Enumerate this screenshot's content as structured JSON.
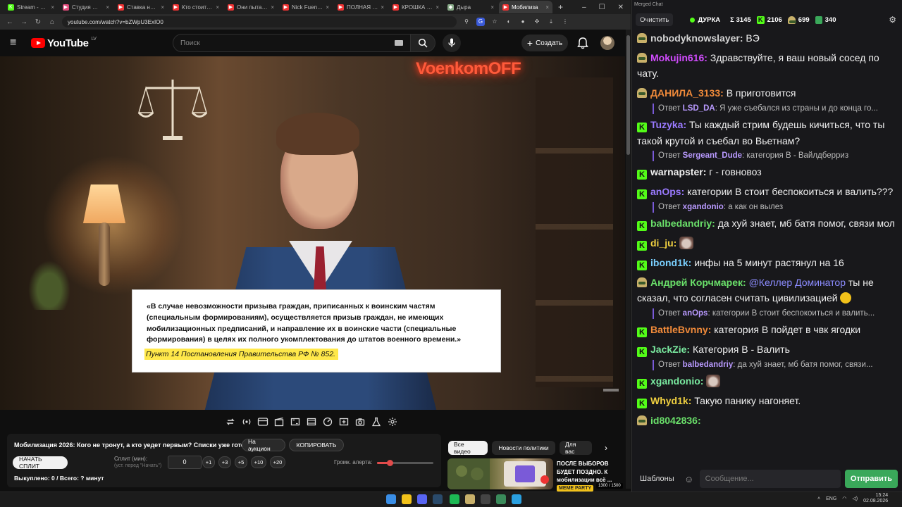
{
  "browser": {
    "tabs": [
      {
        "label": "Stream - Kick D",
        "color": "#53fc18",
        "glyph": "K"
      },
      {
        "label": "Студия — VK В",
        "color": "#e14b7b",
        "glyph": "▶"
      },
      {
        "label": "Ставка на выж",
        "color": "#e33",
        "glyph": "▶"
      },
      {
        "label": "Кто стоит за эт",
        "color": "#e33",
        "glyph": "▶"
      },
      {
        "label": "Они пытались",
        "color": "#e33",
        "glyph": "▶"
      },
      {
        "label": "Nick Fuentes Is",
        "color": "#e33",
        "glyph": "▶"
      },
      {
        "label": "ПОЛНАЯ ВСЕЛ",
        "color": "#e33",
        "glyph": "▶"
      },
      {
        "label": "КРОШКА ВЕНЯ",
        "color": "#e33",
        "glyph": "▶"
      },
      {
        "label": "Дыра",
        "color": "#8a8",
        "glyph": "◆"
      },
      {
        "label": "Мобилиза",
        "color": "#e33",
        "glyph": "▶"
      }
    ],
    "url": "youtube.com/watch?v=bZWpU3ExIO0"
  },
  "youtube": {
    "logo_text": "YouTube",
    "logo_region": "LV",
    "search_placeholder": "Поиск",
    "create_label": "Создать"
  },
  "video": {
    "neon_sign": "VoenkomOFF",
    "quote": "«В случае невозможности призыва граждан, приписанных к воинским частям (специальным формированиям), осуществляется призыв граждан, не имеющих мобилизационных предписаний, и направление их в воинские части (специальные формирования) в целях их полного укомплектования до штатов военного времени.»",
    "quote_source": "Пункт 14 Постановления Правительства РФ № 852."
  },
  "panel": {
    "title": "Мобилизация 2026: Кого не тронут, а кто уедет первым? Списки уже готовы",
    "auction_label": "На аукцион",
    "copy_label": "КОПИРОВАТЬ",
    "split_button": "НАЧАТЬ СПЛИТ",
    "split_label": "Сплит (мин):",
    "split_sublabel": "(уст. перед \"Начать\")",
    "split_value": "0",
    "increments": [
      "+1",
      "+3",
      "+5",
      "+10",
      "+20"
    ],
    "alert_label": "Громк. алерта:",
    "alert_volume": 0.22,
    "bought_text": "Выкуплено: 0 / Всего: ? минут"
  },
  "recommendations": {
    "chips": [
      "Все видео",
      "Новости политики",
      "Для вас"
    ],
    "selected_chip": 0,
    "card_title": "ПОСЛЕ ВЫБОРОВ БУДЕТ ПОЗДНО. К мобилизации всё ...",
    "card_badge": "MEME PARTY",
    "card_duration": "1300 / 1500"
  },
  "chat": {
    "window_title": "Merged Chat",
    "clear_label": "Очистить",
    "channel": "ДУРКА",
    "stat_sum": "Σ 3145",
    "stat_kick": "2106",
    "stat_hat": "699",
    "stat_green": "340",
    "messages": [
      {
        "badge": "hat",
        "user": "nobodyknowslayer",
        "color": "#d4d4d4",
        "text": "ВЭ"
      },
      {
        "badge": "hat",
        "user": "Mokujin616",
        "color": "#d24cff",
        "text": "Здравствуйте, я ваш новый сосед по чату."
      },
      {
        "badge": "hat",
        "user": "ДАНИЛА_3133",
        "color": "#f08a3a",
        "text": "В приготовится",
        "reply_user": "LSD_DA",
        "reply_text": "Я уже съебался из страны и до конца го..."
      },
      {
        "badge": "k",
        "user": "Tuzyka",
        "color": "#9a7aff",
        "text": "Ты каждый стрим будешь кичиться, что ты такой крутой и съебал во Вьетнам?",
        "reply_user": "Sergeant_Dude",
        "reply_text": "категория В - Вайлдберриз"
      },
      {
        "badge": "k",
        "user": "warnapster",
        "color": "#f0f0f0",
        "text": "г - говновоз"
      },
      {
        "badge": "k",
        "user": "anOps",
        "color": "#9a7aff",
        "text": "категории В стоит беспокоиться и валить???",
        "reply_user": "xgandonio",
        "reply_text": "а как он вылез"
      },
      {
        "badge": "k",
        "user": "balbedandriy",
        "color": "#6ae06a",
        "text": "да хуй знает, мб батя помог, связи мол"
      },
      {
        "badge": "k",
        "user": "di_ju",
        "color": "#f0d040",
        "text": "",
        "emote": true
      },
      {
        "badge": "k",
        "user": "ibond1k",
        "color": "#7ad0ff",
        "text": "инфы на 5 минут растянул на 16"
      },
      {
        "badge": "hat",
        "user": "Андрей Корчмарек",
        "color": "#6ae06a",
        "mention": "@Келлер Доминатор",
        "text": "ты не сказал, что согласен считать цивилизацией",
        "smile": true,
        "reply_user": "anOps",
        "reply_text": "категории В стоит беспокоиться и валить..."
      },
      {
        "badge": "k",
        "user": "BattleBvnny",
        "color": "#f08a3a",
        "text": "категория В пойдет в чвк ягодки"
      },
      {
        "badge": "k",
        "user": "JackZie",
        "color": "#7aeaa0",
        "text": "Категория В - Валить",
        "reply_user": "balbedandriy",
        "reply_text": "да хуй знает, мб батя помог, связи..."
      },
      {
        "badge": "k",
        "user": "xgandonio",
        "color": "#7aeaa0",
        "text": "",
        "emote": true
      },
      {
        "badge": "k",
        "user": "Whyd1k",
        "color": "#f0d040",
        "text": "Такую панику нагоняет."
      },
      {
        "badge": "hat",
        "user": "id8042836",
        "color": "#6ae06a",
        "text": ""
      }
    ],
    "templates_label": "Шаблоны",
    "input_placeholder": "Сообщение...",
    "send_label": "Отправить"
  },
  "taskbar": {
    "lang": "ENG",
    "time": "15:24",
    "date": "02.08.2026"
  }
}
